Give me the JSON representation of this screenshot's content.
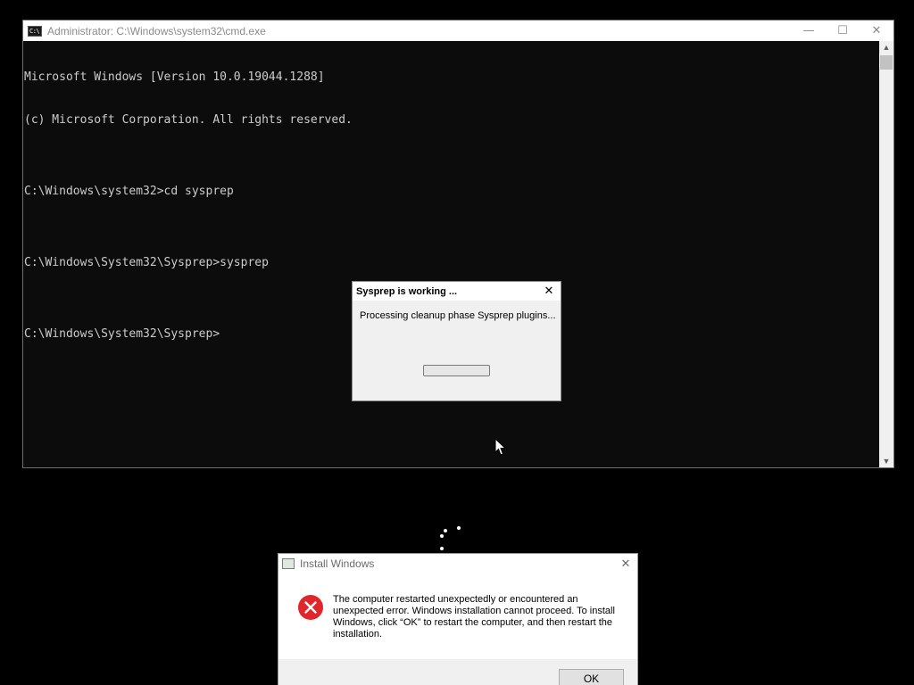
{
  "cmd": {
    "title": "Administrator: C:\\Windows\\system32\\cmd.exe",
    "icon_text": "C:\\",
    "lines": [
      "Microsoft Windows [Version 10.0.19044.1288]",
      "(c) Microsoft Corporation. All rights reserved.",
      "",
      "C:\\Windows\\system32>cd sysprep",
      "",
      "C:\\Windows\\System32\\Sysprep>sysprep",
      "",
      "C:\\Windows\\System32\\Sysprep>"
    ],
    "controls": {
      "minimize": "—",
      "maximize": "☐",
      "close": "✕"
    }
  },
  "sysprep": {
    "title": "Sysprep is working ...",
    "message": "Processing cleanup phase Sysprep plugins...",
    "close": "✕",
    "progress": 0
  },
  "install": {
    "title": "Install Windows",
    "message": "The computer restarted unexpectedly or encountered an unexpected error. Windows installation cannot proceed. To install Windows, click “OK” to restart the computer, and then restart the installation.",
    "close": "✕",
    "ok_label": "OK",
    "error_icon": "error-icon"
  },
  "colors": {
    "console_bg": "#0c0c0c",
    "console_text": "#cccccc",
    "error_red": "#e0262b",
    "progress_green": "#06b025"
  }
}
